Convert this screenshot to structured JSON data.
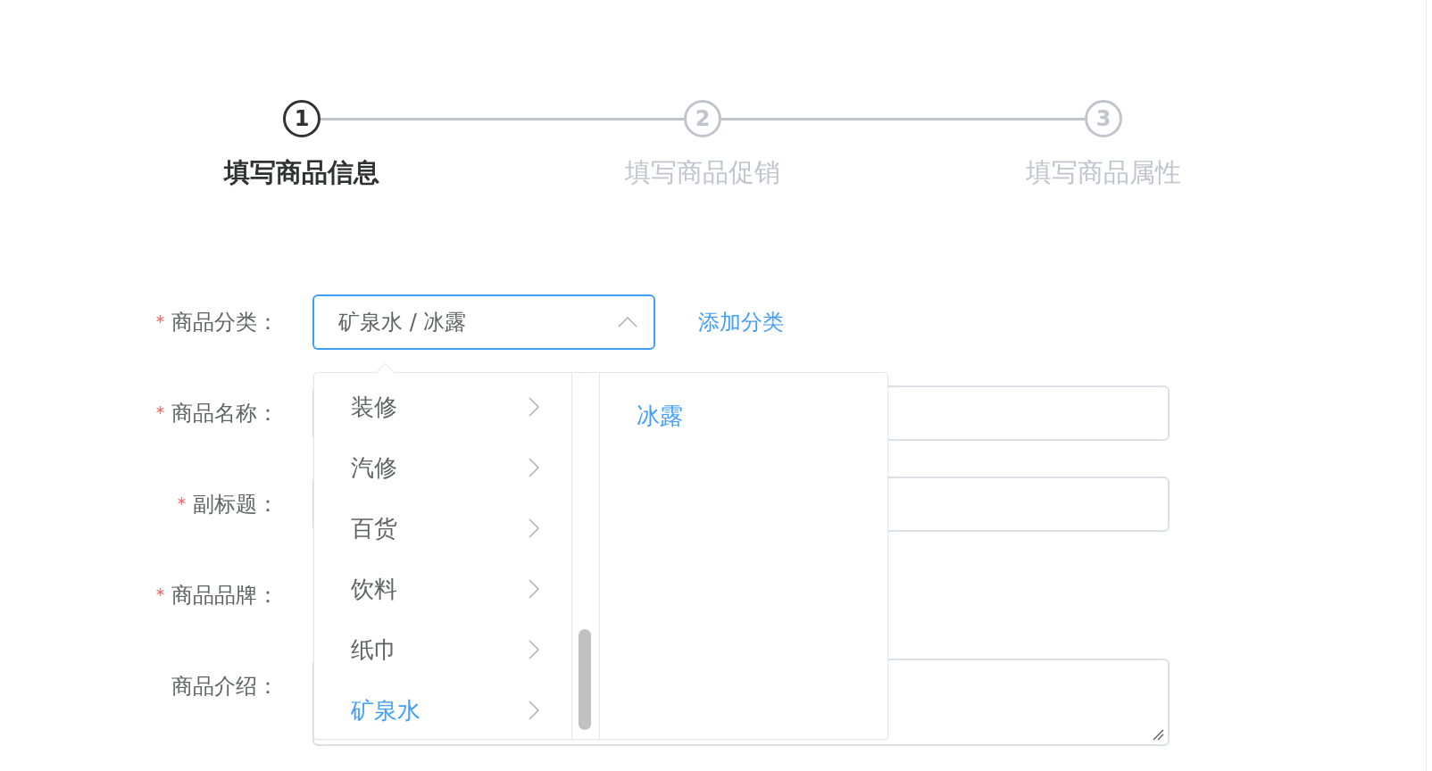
{
  "steps": [
    {
      "number": "1",
      "label": "填写商品信息",
      "active": true
    },
    {
      "number": "2",
      "label": "填写商品促销",
      "active": false
    },
    {
      "number": "3",
      "label": "填写商品属性",
      "active": false
    }
  ],
  "form": {
    "rows": [
      {
        "label": "商品分类：",
        "required": true,
        "kind": "cascader",
        "value": "矿泉水 / 冰露",
        "expanded": true,
        "link": "添加分类"
      },
      {
        "label": "商品名称：",
        "required": true,
        "kind": "input"
      },
      {
        "label": "副标题：",
        "required": true,
        "kind": "input"
      },
      {
        "label": "商品品牌：",
        "required": true,
        "kind": "blank"
      },
      {
        "label": "商品介绍：",
        "required": false,
        "kind": "textarea"
      }
    ]
  },
  "cascader_menu": {
    "columns": [
      {
        "items": [
          {
            "label": "装修",
            "selected": false
          },
          {
            "label": "汽修",
            "selected": false
          },
          {
            "label": "百货",
            "selected": false
          },
          {
            "label": "饮料",
            "selected": false
          },
          {
            "label": "纸巾",
            "selected": false
          },
          {
            "label": "矿泉水",
            "selected": true
          }
        ]
      },
      {
        "items": [
          {
            "label": "冰露",
            "selected": true
          }
        ]
      }
    ]
  }
}
